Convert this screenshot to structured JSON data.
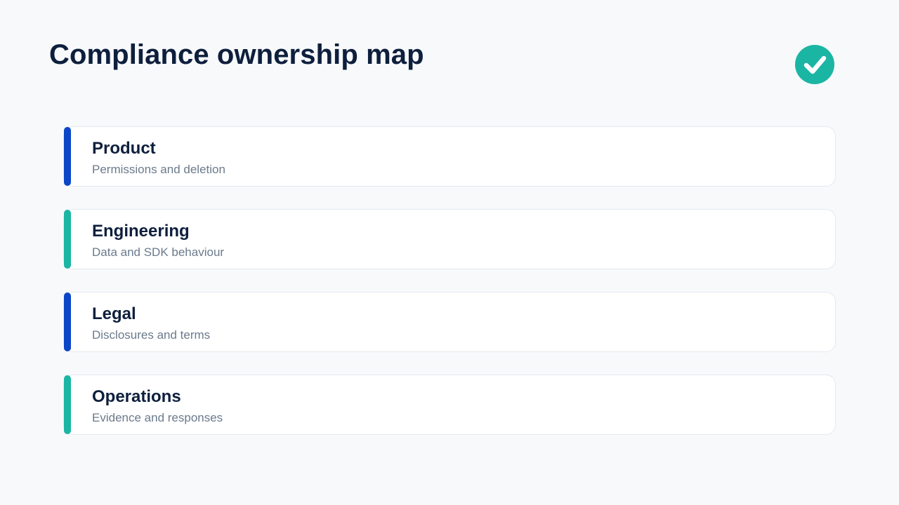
{
  "page": {
    "title": "Compliance ownership map"
  },
  "badge": {
    "icon": "check-icon",
    "color": "#1bb5a4"
  },
  "owners": [
    {
      "title": "Product",
      "subtitle": "Permissions and deletion",
      "accent": "#0b46c8"
    },
    {
      "title": "Engineering",
      "subtitle": "Data and SDK behaviour",
      "accent": "#1bb5a4"
    },
    {
      "title": "Legal",
      "subtitle": "Disclosures and terms",
      "accent": "#0b46c8"
    },
    {
      "title": "Operations",
      "subtitle": "Evidence and responses",
      "accent": "#1bb5a4"
    }
  ]
}
